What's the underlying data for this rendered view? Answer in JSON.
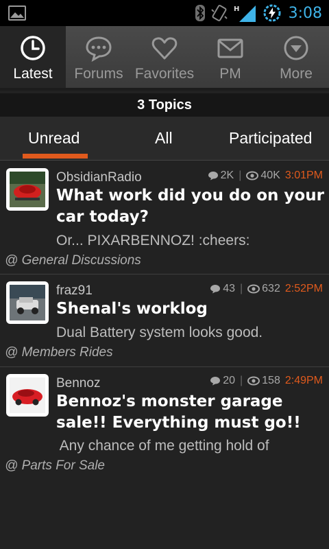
{
  "status_bar": {
    "time": "3:08",
    "icons": [
      "picture-icon",
      "bluetooth-icon",
      "vibrate-icon",
      "signal-icon",
      "battery-charging-icon"
    ],
    "accent_color": "#3fb3e8"
  },
  "tabs": [
    {
      "label": "Latest",
      "icon": "clock-icon",
      "active": true
    },
    {
      "label": "Forums",
      "icon": "chat-bubble-icon",
      "active": false
    },
    {
      "label": "Favorites",
      "icon": "heart-icon",
      "active": false
    },
    {
      "label": "PM",
      "icon": "envelope-icon",
      "active": false
    },
    {
      "label": "More",
      "icon": "chevron-down-circle-icon",
      "active": false
    }
  ],
  "topic_count": "3 Topics",
  "filters": {
    "unread": "Unread",
    "all": "All",
    "participated": "Participated",
    "active": "Unread",
    "accent_color": "#e05a1d"
  },
  "topics": [
    {
      "author": "ObsidianRadio",
      "replies": "2K",
      "views": "40K",
      "time": "3:01PM",
      "title": "What work did you do on your car today?",
      "preview": "Or... PIXARBENNOZ! :cheers:",
      "forum": "@ General Discussions"
    },
    {
      "author": "fraz91",
      "replies": "43",
      "views": "632",
      "time": "2:52PM",
      "title": "Shenal's worklog",
      "preview": "Dual Battery system looks good.",
      "forum": "@ Members Rides"
    },
    {
      "author": "Bennoz",
      "replies": "20",
      "views": "158",
      "time": "2:49PM",
      "title": "Bennoz's monster garage sale!! Everything must go!!",
      "preview": " Any chance of me getting hold of",
      "forum": "@ Parts For Sale"
    }
  ]
}
